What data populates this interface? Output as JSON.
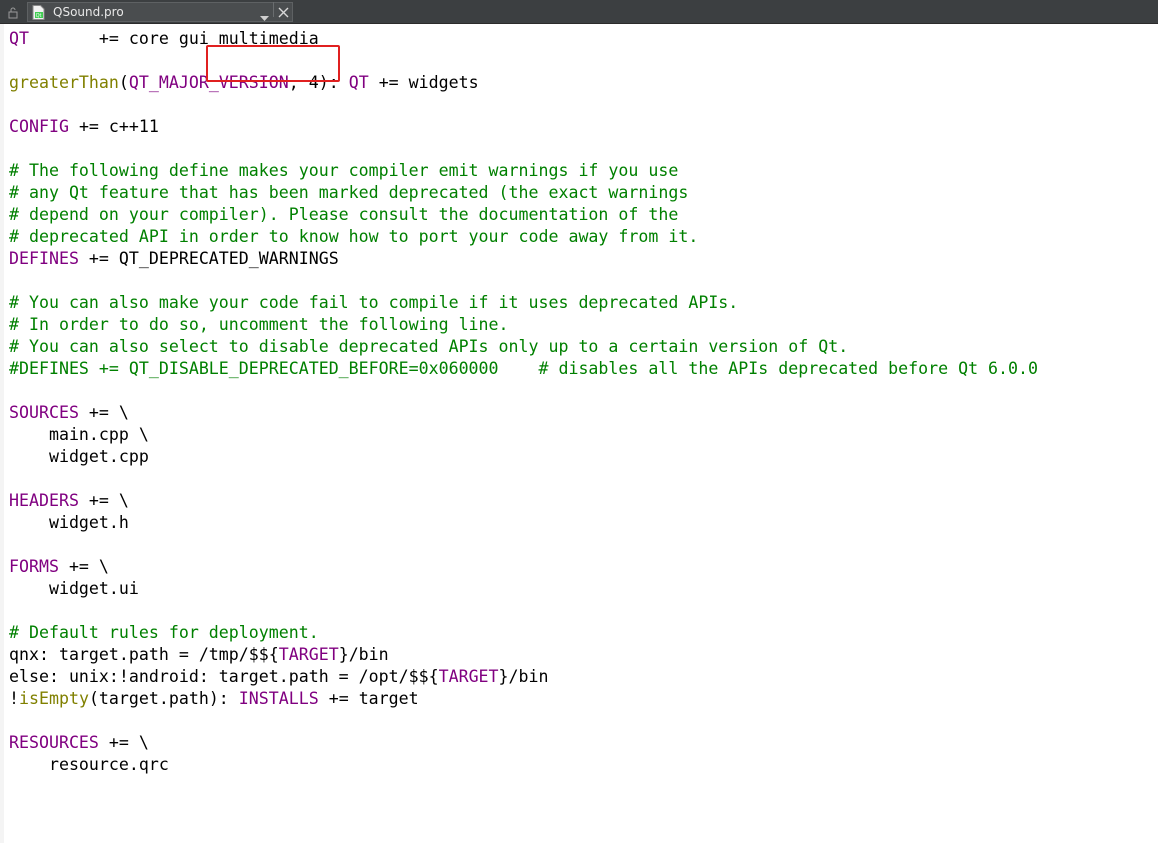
{
  "tab": {
    "filename": "QSound.pro",
    "lock_icon": "unlock-icon",
    "file_icon": "qt-project-file-icon",
    "dropdown_icon": "triangle-down-icon",
    "close_icon": "close-icon"
  },
  "colors": {
    "keyword": "#800080",
    "function": "#808000",
    "comment": "#008000",
    "text": "#000000",
    "highlight_border": "#e02020"
  },
  "code_lines": [
    [
      {
        "t": "QT",
        "c": "keyword"
      },
      {
        "t": "       += core gui multimedia",
        "c": "plain"
      }
    ],
    [],
    [
      {
        "t": "greaterThan",
        "c": "func"
      },
      {
        "t": "(",
        "c": "plain"
      },
      {
        "t": "QT_MAJOR_VERSION",
        "c": "keyword"
      },
      {
        "t": ", 4): ",
        "c": "plain"
      },
      {
        "t": "QT",
        "c": "keyword"
      },
      {
        "t": " += widgets",
        "c": "plain"
      }
    ],
    [],
    [
      {
        "t": "CONFIG",
        "c": "keyword"
      },
      {
        "t": " += c++11",
        "c": "plain"
      }
    ],
    [],
    [
      {
        "t": "# The following define makes your compiler emit warnings if you use",
        "c": "comment"
      }
    ],
    [
      {
        "t": "# any Qt feature that has been marked deprecated (the exact warnings",
        "c": "comment"
      }
    ],
    [
      {
        "t": "# depend on your compiler). Please consult the documentation of the",
        "c": "comment"
      }
    ],
    [
      {
        "t": "# deprecated API in order to know how to port your code away from it.",
        "c": "comment"
      }
    ],
    [
      {
        "t": "DEFINES",
        "c": "keyword"
      },
      {
        "t": " += QT_DEPRECATED_WARNINGS",
        "c": "plain"
      }
    ],
    [],
    [
      {
        "t": "# You can also make your code fail to compile if it uses deprecated APIs.",
        "c": "comment"
      }
    ],
    [
      {
        "t": "# In order to do so, uncomment the following line.",
        "c": "comment"
      }
    ],
    [
      {
        "t": "# You can also select to disable deprecated APIs only up to a certain version of Qt.",
        "c": "comment"
      }
    ],
    [
      {
        "t": "#DEFINES += QT_DISABLE_DEPRECATED_BEFORE=0x060000    # disables all the APIs deprecated before Qt 6.0.0",
        "c": "comment"
      }
    ],
    [],
    [
      {
        "t": "SOURCES",
        "c": "keyword"
      },
      {
        "t": " += \\",
        "c": "plain"
      }
    ],
    [
      {
        "t": "    main.cpp \\",
        "c": "plain"
      }
    ],
    [
      {
        "t": "    widget.cpp",
        "c": "plain"
      }
    ],
    [],
    [
      {
        "t": "HEADERS",
        "c": "keyword"
      },
      {
        "t": " += \\",
        "c": "plain"
      }
    ],
    [
      {
        "t": "    widget.h",
        "c": "plain"
      }
    ],
    [],
    [
      {
        "t": "FORMS",
        "c": "keyword"
      },
      {
        "t": " += \\",
        "c": "plain"
      }
    ],
    [
      {
        "t": "    widget.ui",
        "c": "plain"
      }
    ],
    [],
    [
      {
        "t": "# Default rules for deployment.",
        "c": "comment"
      }
    ],
    [
      {
        "t": "qnx: target.path = /tmp/$${",
        "c": "plain"
      },
      {
        "t": "TARGET",
        "c": "keyword"
      },
      {
        "t": "}/bin",
        "c": "plain"
      }
    ],
    [
      {
        "t": "else: unix:!android: target.path = /opt/$${",
        "c": "plain"
      },
      {
        "t": "TARGET",
        "c": "keyword"
      },
      {
        "t": "}/bin",
        "c": "plain"
      }
    ],
    [
      {
        "t": "!",
        "c": "plain"
      },
      {
        "t": "isEmpty",
        "c": "func"
      },
      {
        "t": "(target.path): ",
        "c": "plain"
      },
      {
        "t": "INSTALLS",
        "c": "keyword"
      },
      {
        "t": " += target",
        "c": "plain"
      }
    ],
    [],
    [
      {
        "t": "RESOURCES",
        "c": "keyword"
      },
      {
        "t": " += \\",
        "c": "plain"
      }
    ],
    [
      {
        "t": "    resource.qrc",
        "c": "plain"
      }
    ]
  ]
}
